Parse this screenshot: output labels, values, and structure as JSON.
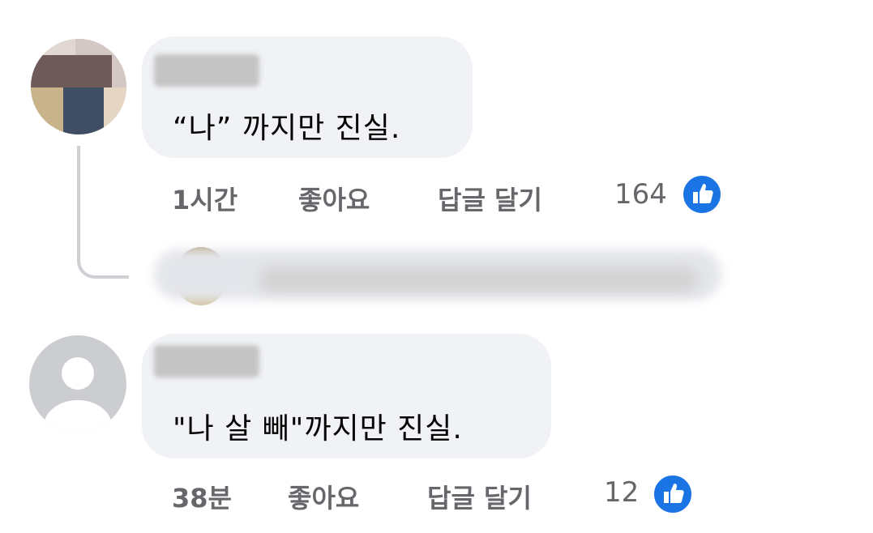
{
  "colors": {
    "bubble_bg": "#f0f2f5",
    "meta_text": "#65676b",
    "like_blue": "#1b74e4",
    "thread_line": "#ced0d4"
  },
  "comments": [
    {
      "name_redacted": true,
      "text": "“나” 까지만 진실.",
      "time": "1시간",
      "like_label": "좋아요",
      "reply_label": "답글 달기",
      "like_count": "164",
      "like_icon": "thumbs-up-icon"
    },
    {
      "name_redacted": true,
      "text": "\"나 살 빼\"까지만 진실.",
      "time": "38분",
      "like_label": "좋아요",
      "reply_label": "답글 달기",
      "like_count": "12",
      "like_icon": "thumbs-up-icon"
    }
  ],
  "reply_preview": {
    "redacted": true
  }
}
